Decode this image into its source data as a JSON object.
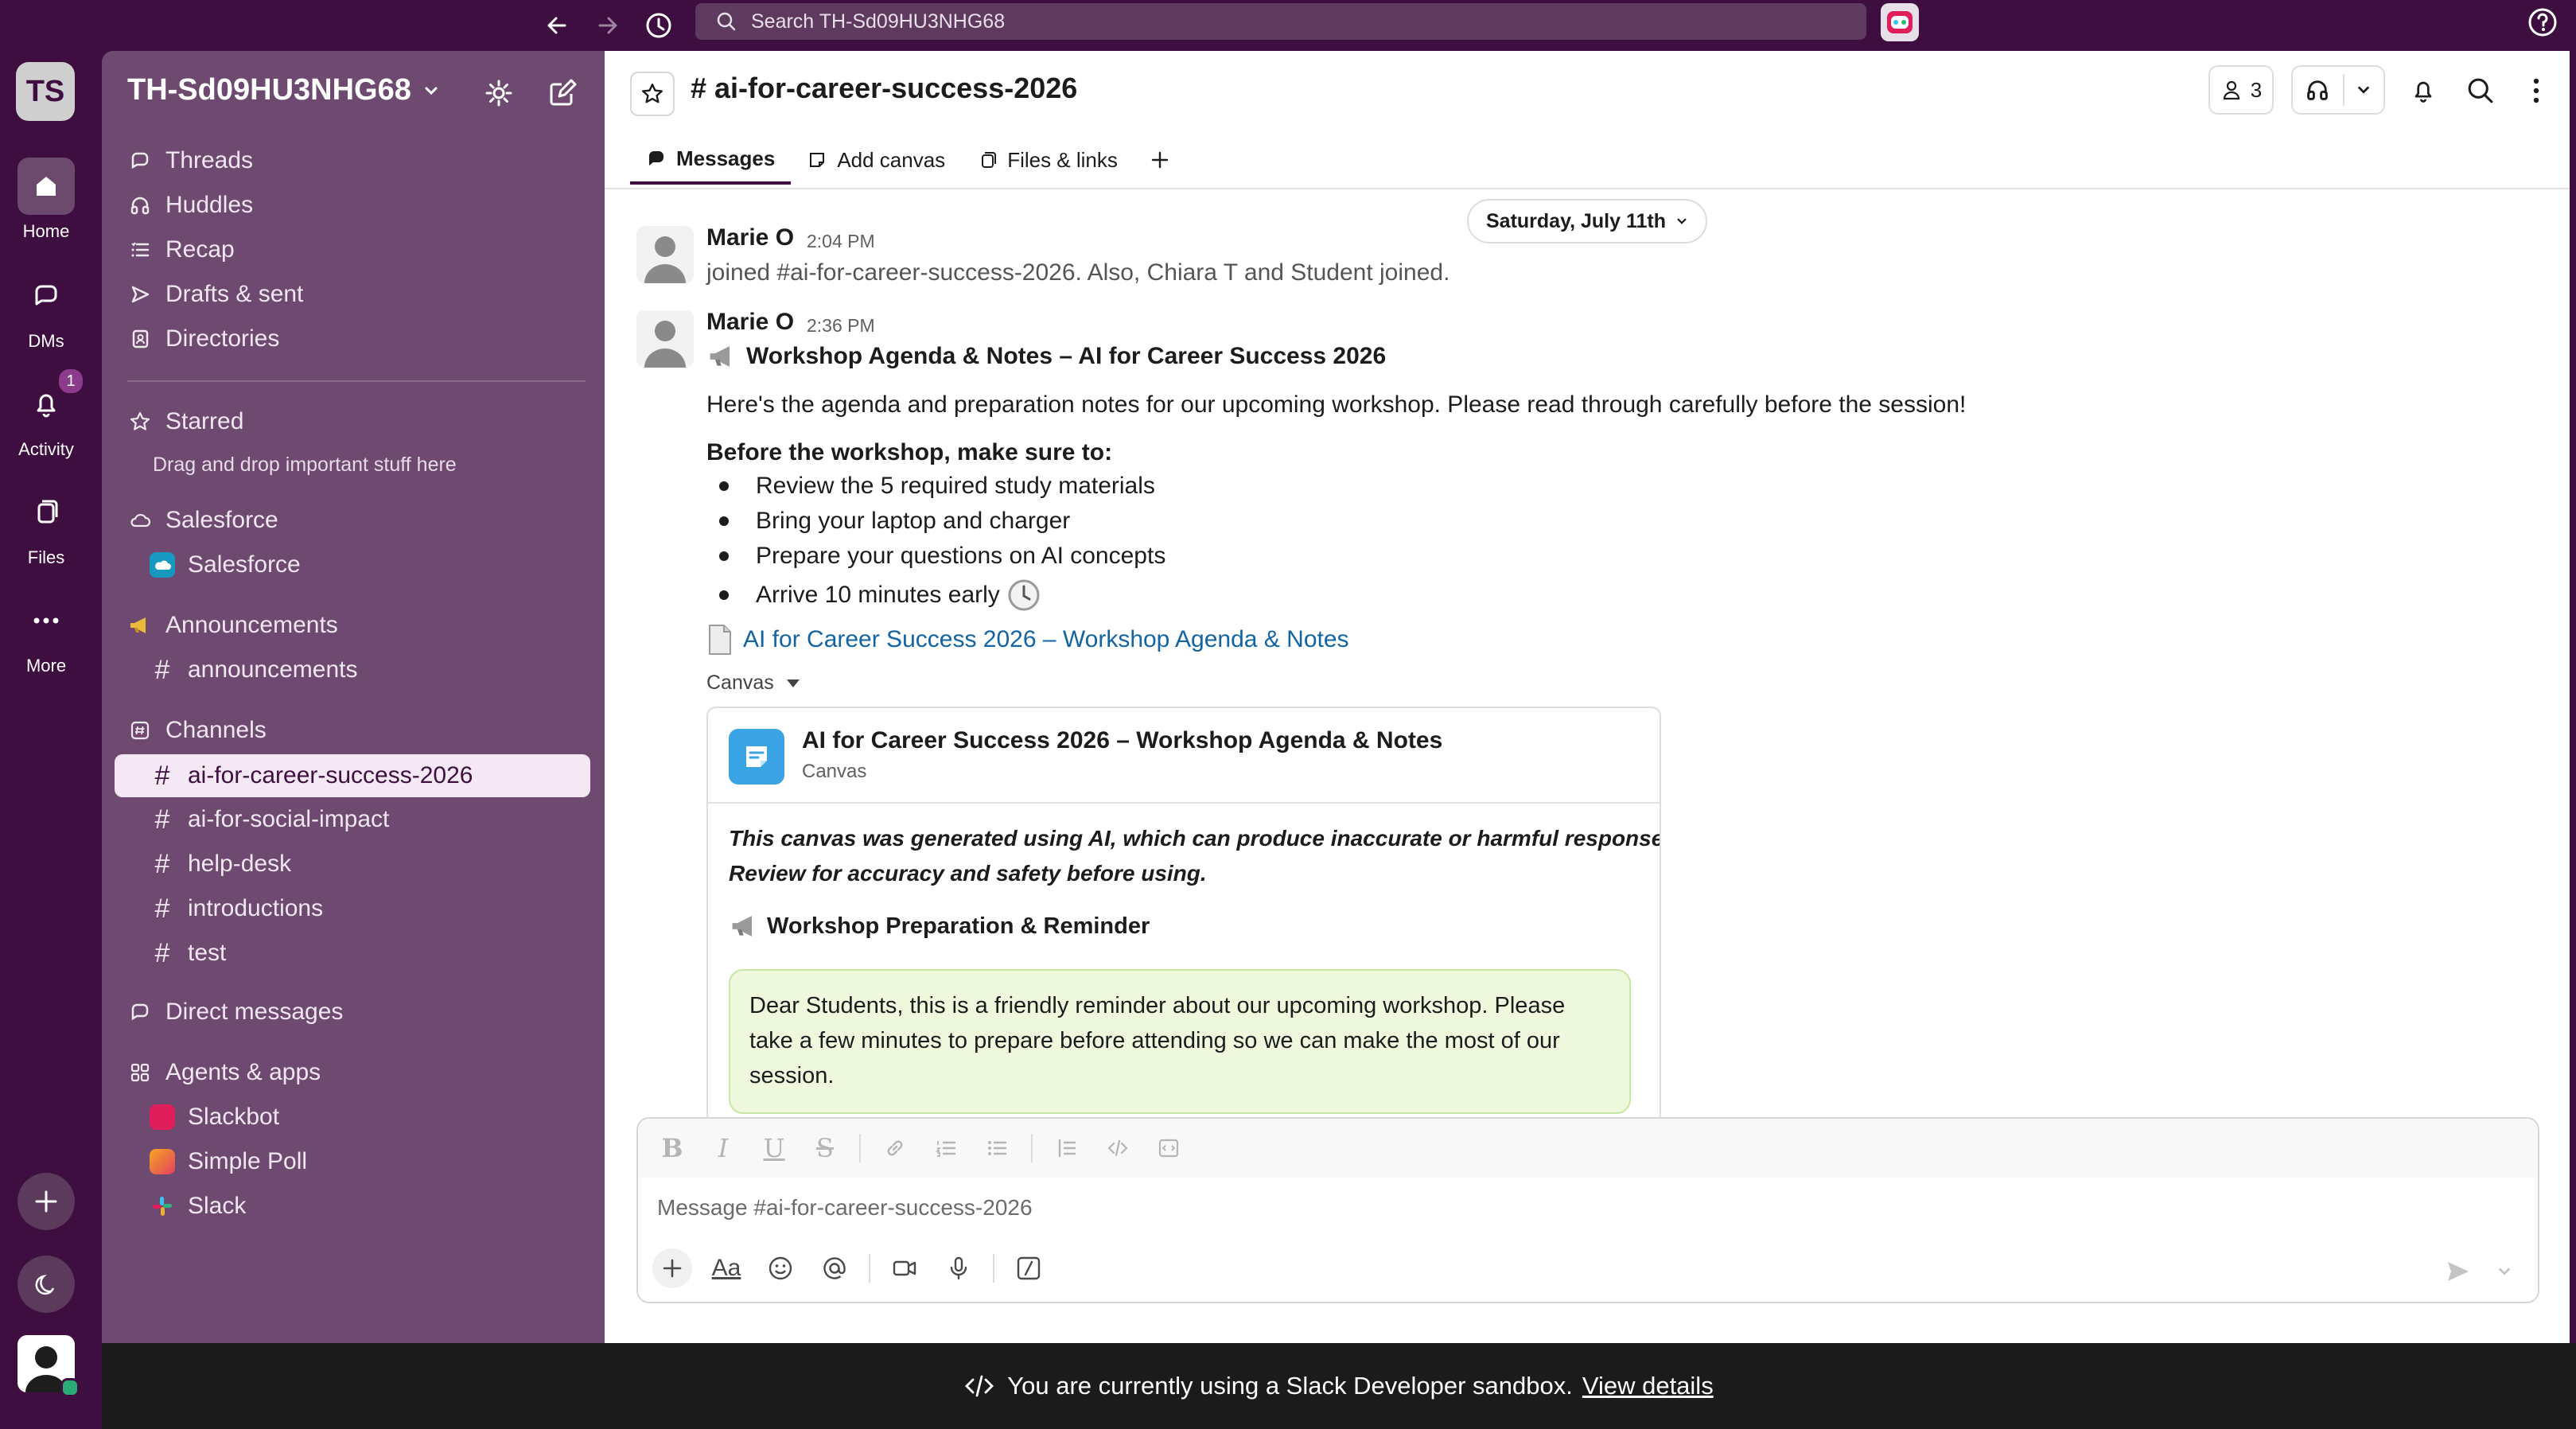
{
  "topbar": {
    "search_placeholder": "Search TH-Sd09HU3NHG68"
  },
  "rail": {
    "workspace_initials": "TS",
    "items": [
      {
        "label": "Home",
        "icon": "home-icon"
      },
      {
        "label": "DMs",
        "icon": "dm-icon"
      },
      {
        "label": "Activity",
        "icon": "bell-icon",
        "badge": "1"
      },
      {
        "label": "Files",
        "icon": "files-icon"
      },
      {
        "label": "More",
        "icon": "more-icon"
      }
    ]
  },
  "sidebar": {
    "workspace_name": "TH-Sd09HU3NHG68",
    "nav": [
      "Threads",
      "Huddles",
      "Recap",
      "Drafts & sent",
      "Directories"
    ],
    "starred": {
      "label": "Starred",
      "hint": "Drag and drop important stuff here"
    },
    "salesforce_section": {
      "label": "Salesforce",
      "items": [
        "Salesforce"
      ]
    },
    "announcements_section": {
      "label": "Announcements",
      "items": [
        "announcements"
      ]
    },
    "channels_section": {
      "label": "Channels",
      "items": [
        "ai-for-career-success-2026",
        "ai-for-social-impact",
        "help-desk",
        "introductions",
        "test"
      ],
      "active": "ai-for-career-success-2026"
    },
    "direct_messages_label": "Direct messages",
    "agents_section": {
      "label": "Agents & apps",
      "items": [
        "Slackbot",
        "Simple Poll",
        "Slack"
      ]
    }
  },
  "channel": {
    "title": "# ai-for-career-success-2026",
    "member_count": "3",
    "tabs": [
      "Messages",
      "Add canvas",
      "Files & links"
    ]
  },
  "messages": {
    "date_divider": "Saturday, July 11th",
    "msg1": {
      "author": "Marie O",
      "time": "2:04 PM",
      "text": "joined #ai-for-career-success-2026. Also, Chiara T and Student joined."
    },
    "msg2": {
      "author": "Marie O",
      "time": "2:36 PM",
      "headline": "Workshop Agenda & Notes – AI for Career Success 2026",
      "intro": "Here's the agenda and preparation notes for our upcoming workshop. Please read through carefully before the session!",
      "list_title": "Before the workshop, make sure to:",
      "bullets": [
        "Review the 5 required study materials",
        "Bring your laptop and charger",
        "Prepare your questions on AI concepts",
        "Arrive 10 minutes early"
      ],
      "link_text": "AI for Career Success 2026 – Workshop Agenda & Notes",
      "attachment_label": "Canvas"
    }
  },
  "canvas_card": {
    "title": "AI for Career Success 2026 – Workshop Agenda & Notes",
    "subtitle": "Canvas",
    "disclaimer_line1": "This canvas was generated using AI, which can produce inaccurate or harmful responses.",
    "disclaimer_line2": "Review for accuracy and safety before using.",
    "section_title": "Workshop Preparation & Reminder",
    "callout": "Dear Students, this is a friendly reminder about our upcoming workshop. Please take a few minutes to prepare before attending so we can make the most of our session."
  },
  "composer": {
    "placeholder": "Message #ai-for-career-success-2026"
  },
  "footer": {
    "text": "You are currently using a Slack Developer sandbox.",
    "link": "View details"
  },
  "colors": {
    "aubergine": "#3f0e40",
    "sidebar": "#6e4a70",
    "link": "#1264a3",
    "canvas_blue": "#3aa3e3",
    "callout_green": "#eef8dc"
  }
}
